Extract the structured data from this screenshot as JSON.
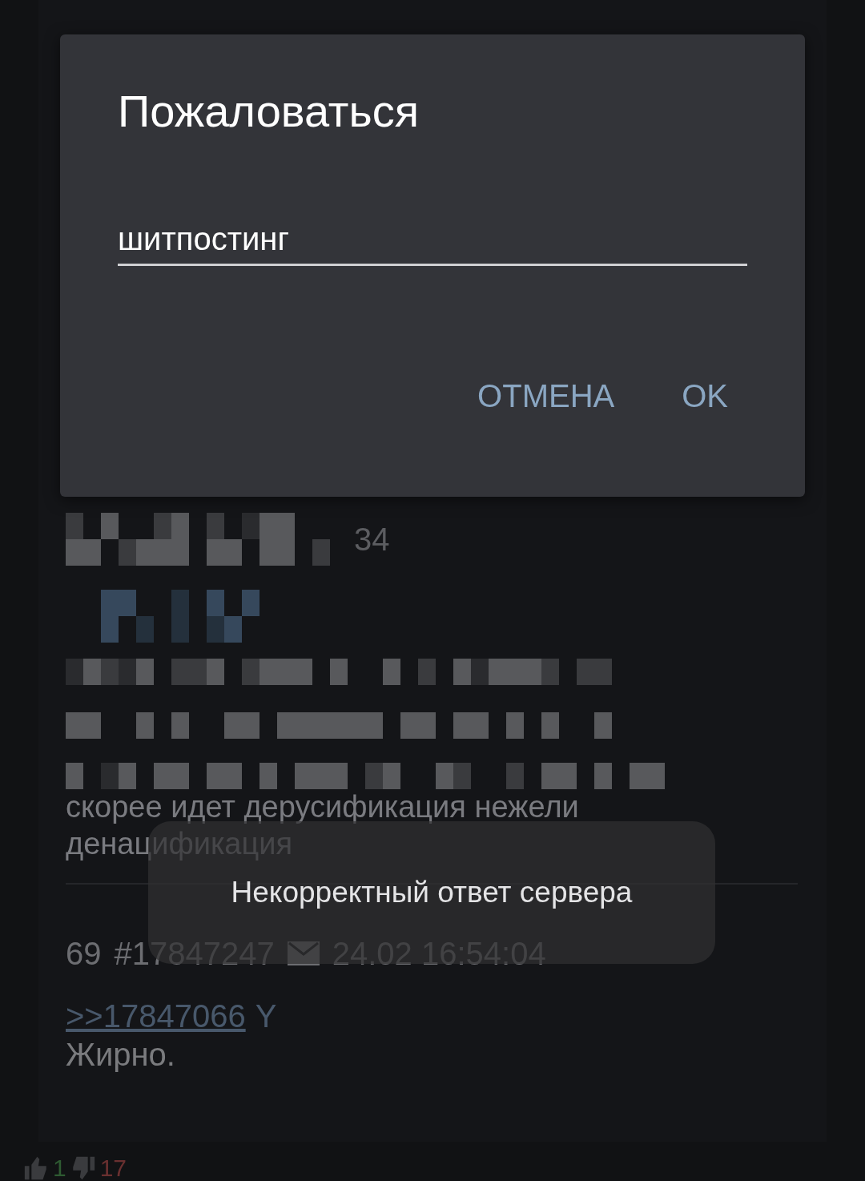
{
  "report_dialog": {
    "title": "Пожаловаться",
    "input": {
      "value": "шитпостинг"
    },
    "buttons": [
      {
        "label": "ОТМЕНА"
      },
      {
        "label": "OK"
      }
    ]
  },
  "post_preview": {
    "header_tail": "34",
    "post_text": [
      "скорее идет дерусификация нежели",
      "денацификация"
    ],
    "reply": {
      "number": "69",
      "post_id": "#17847247",
      "date": "24.02 16:54:04",
      "quote_link": ">>17847066",
      "quote_mark": "Y",
      "text": "Жирно."
    }
  },
  "background_post": {
    "likes": "1",
    "dislikes": "17"
  },
  "toast": "Некорректный ответ сервера"
}
